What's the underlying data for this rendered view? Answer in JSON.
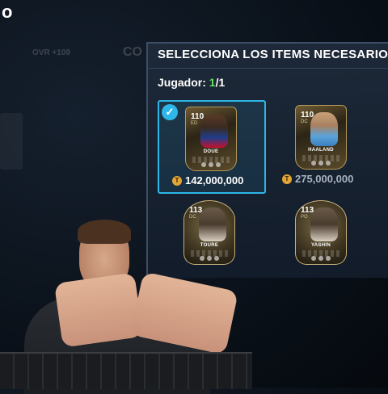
{
  "top_logo": "o",
  "background": {
    "ovr_text": "OVR +109",
    "co_text": "CO"
  },
  "panel": {
    "title": "SELECCIONA LOS ITEMS NECESARIOS",
    "jugador_label": "Jugador:",
    "count_selected": "1",
    "count_total": "/1"
  },
  "cards": [
    {
      "rating": "110",
      "position": "ED",
      "name": "DOUE",
      "price": "142,000,000",
      "selected": true,
      "check_icon": "check-icon"
    },
    {
      "rating": "110",
      "position": "DC",
      "name": "HAALAND",
      "price": "275,000,000",
      "selected": false
    },
    {
      "rating": "113",
      "position": "DC",
      "name": "TOURE",
      "price": "",
      "selected": false
    },
    {
      "rating": "113",
      "position": "PO",
      "name": "YASHIN",
      "price": "",
      "selected": false
    }
  ],
  "colors": {
    "accent": "#2fb6e8",
    "count_green": "#5fe35f",
    "coin": "#e3a636"
  }
}
